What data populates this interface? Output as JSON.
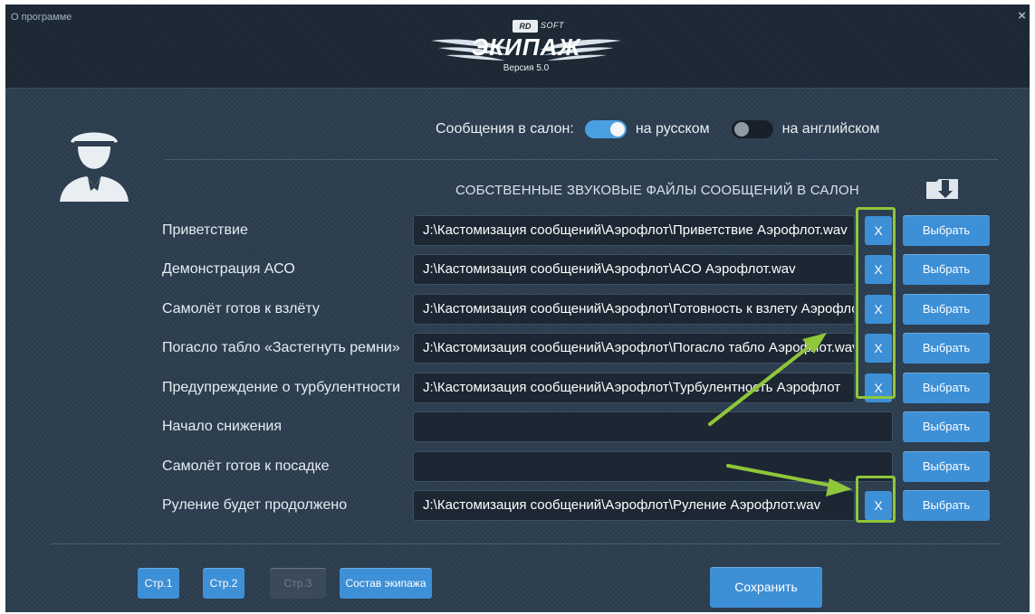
{
  "window": {
    "about_link": "О программе",
    "close_label": "×"
  },
  "logo": {
    "brand_badge": "RD",
    "brand_suffix": "SOFT",
    "title": "ЭКИПАЖ",
    "version": "Версия 5.0"
  },
  "language": {
    "label": "Сообщения в салон:",
    "option_ru": "на русском",
    "option_en": "на английском",
    "selected": "ru"
  },
  "section_title": "СОБСТВЕННЫЕ ЗВУКОВЫЕ ФАЙЛЫ СООБЩЕНИЙ В САЛОН",
  "messages": [
    {
      "label": "Приветствие",
      "path": "J:\\Кастомизация сообщений\\Аэрофлот\\Приветствие Аэрофлот.wav",
      "has_file": true
    },
    {
      "label": "Демонстрация АСО",
      "path": "J:\\Кастомизация сообщений\\Аэрофлот\\АСО Аэрофлот.wav",
      "has_file": true
    },
    {
      "label": "Самолёт готов к взлёту",
      "path": "J:\\Кастомизация сообщений\\Аэрофлот\\Готовность к взлету Аэрофлот.wav",
      "has_file": true
    },
    {
      "label": "Погасло табло «Застегнуть ремни»",
      "path": "J:\\Кастомизация сообщений\\Аэрофлот\\Погасло табло Аэрофлот.wav",
      "has_file": true
    },
    {
      "label": "Предупреждение о турбулентности",
      "path": "J:\\Кастомизация сообщений\\Аэрофлот\\Турбулентность Аэрофлот",
      "has_file": true
    },
    {
      "label": "Начало снижения",
      "path": "",
      "has_file": false
    },
    {
      "label": "Самолёт готов к посадке",
      "path": "",
      "has_file": false
    },
    {
      "label": "Руление будет продолжено",
      "path": "J:\\Кастомизация сообщений\\Аэрофлот\\Руление Аэрофлот.wav",
      "has_file": true
    }
  ],
  "clear_label": "X",
  "choose_label": "Выбрать",
  "pages": {
    "p1": "Стр.1",
    "p2": "Стр.2",
    "p3": "Стр.3",
    "crew": "Состав экипажа"
  },
  "save_label": "Сохранить",
  "colors": {
    "accent": "#3d8fd6",
    "highlight": "#8fc63a",
    "background": "#2c3e4f"
  }
}
